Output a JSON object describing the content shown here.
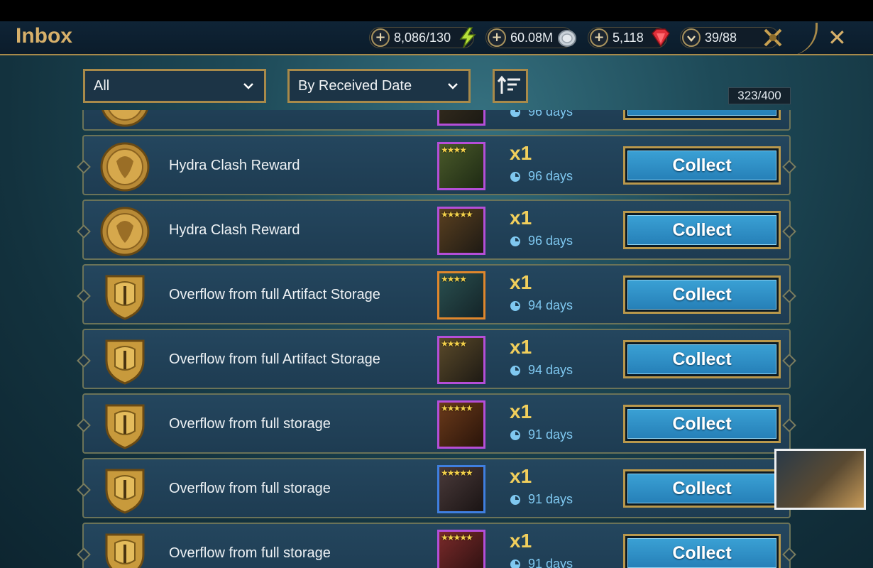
{
  "header": {
    "title": "Inbox",
    "resources": [
      {
        "value": "8,086/130",
        "icon": "energy-icon",
        "action": "plus"
      },
      {
        "value": "60.08M",
        "icon": "silver-icon",
        "action": "plus"
      },
      {
        "value": "5,118",
        "icon": "gem-icon",
        "action": "plus"
      },
      {
        "value": "39/88",
        "icon": "keys-icon",
        "action": "down"
      }
    ],
    "close_icon": "close-icon"
  },
  "filters": {
    "type_selected": "All",
    "sort_selected": "By Received Date",
    "sort_order_icon": "sort-order-icon",
    "counter": "323/400"
  },
  "partial_row": {
    "days": "96 days"
  },
  "rows": [
    {
      "title": "Hydra Clash Reward",
      "icon": "hydra-medal-icon",
      "item_icon": "artifact-icon",
      "rarity": "epic",
      "stars": "★★★★",
      "qty": "x1",
      "days": "96 days",
      "button": "Collect"
    },
    {
      "title": "Hydra Clash Reward",
      "icon": "hydra-medal-icon",
      "item_icon": "artifact-icon",
      "rarity": "epic",
      "stars": "★★★★★",
      "qty": "x1",
      "days": "96 days",
      "button": "Collect"
    },
    {
      "title": "Overflow from full Artifact Storage",
      "icon": "helmet-shield-icon",
      "item_icon": "artifact-icon",
      "rarity": "legendary",
      "stars": "★★★★",
      "qty": "x1",
      "days": "94 days",
      "button": "Collect"
    },
    {
      "title": "Overflow from full Artifact Storage",
      "icon": "helmet-shield-icon",
      "item_icon": "artifact-icon",
      "rarity": "epic",
      "stars": "★★★★",
      "qty": "x1",
      "days": "94 days",
      "button": "Collect"
    },
    {
      "title": "Overflow from full storage",
      "icon": "helmet-shield-icon",
      "item_icon": "artifact-icon",
      "rarity": "epic",
      "stars": "★★★★★",
      "qty": "x1",
      "days": "91 days",
      "button": "Collect"
    },
    {
      "title": "Overflow from full storage",
      "icon": "helmet-shield-icon",
      "item_icon": "artifact-icon",
      "rarity": "rare",
      "stars": "★★★★★",
      "qty": "x1",
      "days": "91 days",
      "button": "Collect"
    },
    {
      "title": "Overflow from full storage",
      "icon": "helmet-shield-icon",
      "item_icon": "artifact-icon",
      "rarity": "epic",
      "stars": "★★★★★",
      "qty": "x1",
      "days": "91 days",
      "button": "Collect"
    }
  ],
  "colors": {
    "gold": "#d7b06a",
    "epic": "#b54ed8",
    "legendary": "#e0872c",
    "rare": "#3f7fe0",
    "button": "#2f90c6",
    "days": "#7fc8f0",
    "qty": "#f1cf5c"
  }
}
